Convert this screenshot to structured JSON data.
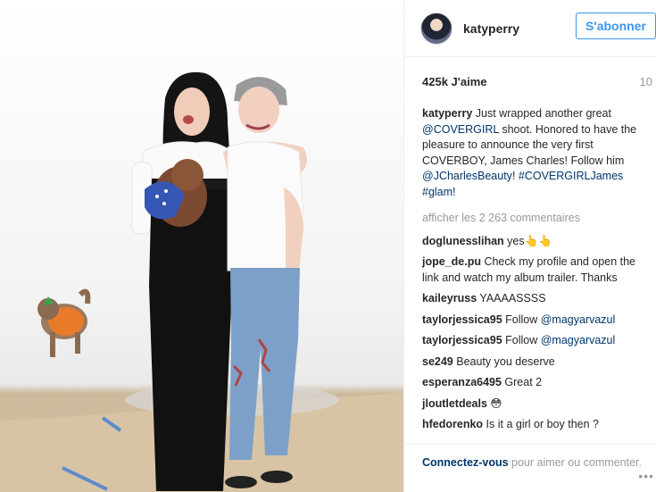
{
  "post": {
    "username": "katyperry",
    "follow_label": "S'abonner",
    "likes": "425k J'aime",
    "age": "10",
    "caption": {
      "user": "katyperry",
      "text_1": " Just wrapped another great ",
      "mention_1": "@COVERGIRL",
      "text_2": " shoot. Honored to have the pleasure to announce the very first COVERBOY, James Charles! Follow him ",
      "mention_2": "@JCharlesBeauty",
      "text_3": "! ",
      "tag_1": "#COVERGIRLJames",
      "text_4": " ",
      "tag_2": "#glam",
      "text_5": "!"
    },
    "view_all_comments": "afficher les 2 263 commentaires",
    "comments": [
      {
        "user": "doglunesslihan",
        "text": " yes👆👆"
      },
      {
        "user": "jope_de.pu",
        "text": " Check my profile and open the link and watch my album trailer. Thanks"
      },
      {
        "user": "kaileyruss",
        "text": " YAAAASSSS"
      },
      {
        "user": "taylorjessica95",
        "text": " Follow ",
        "mention": "@magyarvazul"
      },
      {
        "user": "taylorjessica95",
        "text": " Follow ",
        "mention": "@magyarvazul"
      },
      {
        "user": "se249",
        "text": " Beauty you deserve"
      },
      {
        "user": "esperanza6495",
        "text": " Great 2"
      },
      {
        "user": "jloutletdeals",
        "text": " 😳"
      },
      {
        "user": "hfedorenko",
        "text": " Is it a girl or boy then ?"
      }
    ],
    "footer": {
      "login_label": "Connectez-vous",
      "rest": " pour aimer ou commenter.",
      "more_icon": "•••"
    }
  },
  "colors": {
    "follow_blue": "#3897f0",
    "link_blue": "#003569",
    "muted": "#999999",
    "dress": "#111111",
    "jeans": "#7da0c8"
  },
  "icons": {
    "avatar": "profile-avatar",
    "more": "more-options-icon"
  }
}
